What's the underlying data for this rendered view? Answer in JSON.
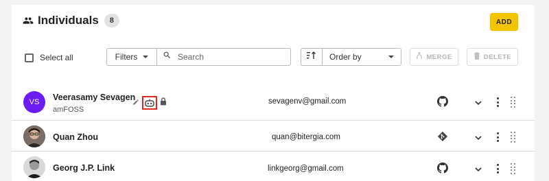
{
  "header": {
    "title": "Individuals",
    "count": "8",
    "add_label": "ADD",
    "icon": "people-icon"
  },
  "toolbar": {
    "select_all_label": "Select all",
    "filters_label": "Filters",
    "search_placeholder": "Search",
    "order_by_label": "Order by",
    "merge_label": "MERGE",
    "delete_label": "DELETE"
  },
  "individuals": [
    {
      "name": "Veerasamy Sevagen",
      "initials": "VS",
      "organization": "amFOSS",
      "email": "sevagenv@gmail.com",
      "source_icon": "github-icon",
      "avatar_color": "#6b1cf0",
      "flags": [
        "edit-icon",
        "bot-icon",
        "lock-icon"
      ]
    },
    {
      "name": "Quan Zhou",
      "organization": "",
      "email": "quan@bitergia.com",
      "source_icon": "git-icon"
    },
    {
      "name": "Georg J.P. Link",
      "organization": "",
      "email": "linkgeorg@gmail.com",
      "source_icon": "github-icon"
    }
  ],
  "colors": {
    "accent": "#f5c400",
    "highlight": "#e2261d",
    "avatar": "#6b1cf0"
  }
}
